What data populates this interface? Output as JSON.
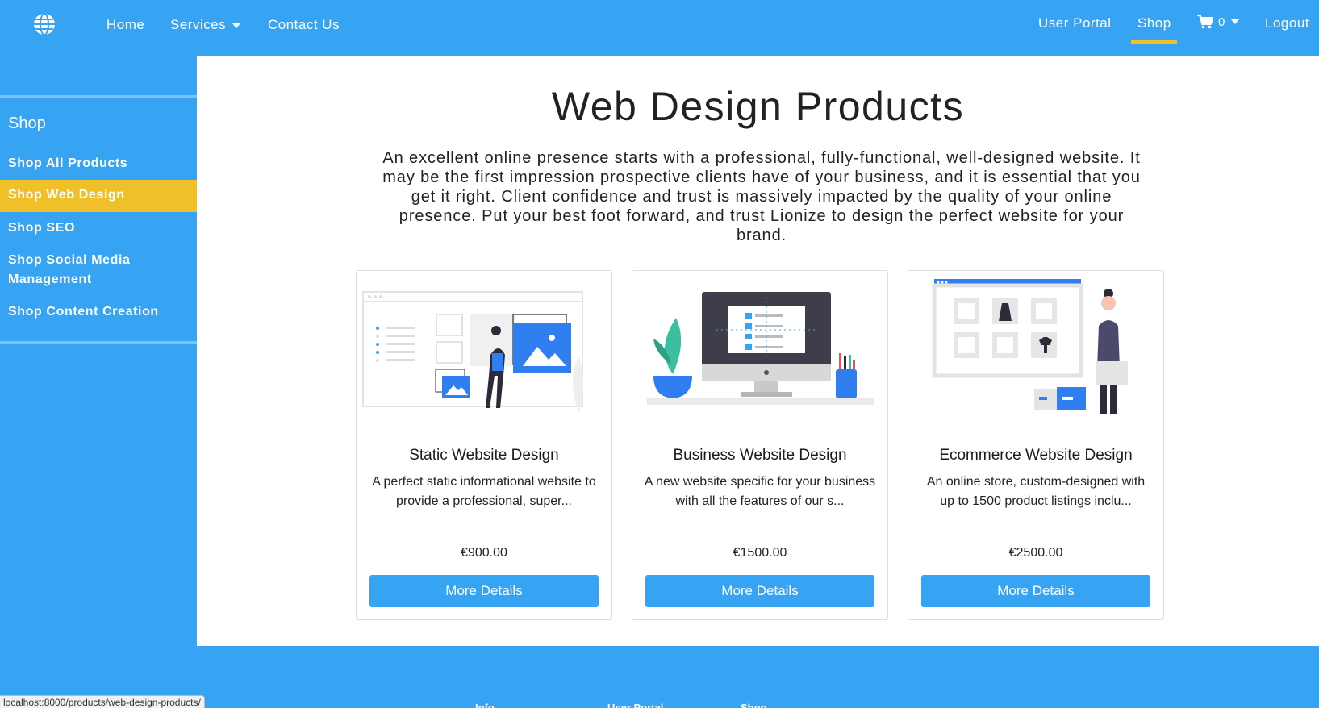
{
  "nav": {
    "home": "Home",
    "services": "Services",
    "contact": "Contact Us",
    "user_portal": "User Portal",
    "shop": "Shop",
    "cart_count": "0",
    "logout": "Logout"
  },
  "sidebar": {
    "title": "Shop",
    "items": [
      {
        "label": "Shop All Products",
        "active": false
      },
      {
        "label": "Shop Web Design",
        "active": true
      },
      {
        "label": "Shop SEO",
        "active": false
      },
      {
        "label": "Shop Social Media Management",
        "active": false
      },
      {
        "label": "Shop Content Creation",
        "active": false
      }
    ]
  },
  "main": {
    "title": "Web Design Products",
    "intro": "An excellent online presence starts with a professional, fully-functional, well-designed website. It may be the first impression prospective clients have of your business, and it is essential that you get it right. Client confidence and trust is massively impacted by the quality of your online presence. Put your best foot forward, and trust Lionize to design the perfect website for your brand.",
    "products": [
      {
        "title": "Static Website Design",
        "description": "A perfect static informational website to provide a professional, super...",
        "price": "€900.00",
        "button": "More Details"
      },
      {
        "title": "Business Website Design",
        "description": "A new website specific for your business with all the features of our s...",
        "price": "€1500.00",
        "button": "More Details"
      },
      {
        "title": "Ecommerce Website Design",
        "description": "An online store, custom-designed with up to 1500 product listings inclu...",
        "price": "€2500.00",
        "button": "More Details"
      }
    ]
  },
  "footer": {
    "headings": [
      "Info",
      "User Portal",
      "Shop"
    ]
  },
  "status_bar": {
    "url": "localhost:8000/products/web-design-products/"
  },
  "colors": {
    "brand_blue": "#36a3f3",
    "accent_yellow": "#f0c02a",
    "white": "#ffffff"
  },
  "icons": {
    "logo": "globe-icon",
    "cart": "shopping-cart-icon"
  }
}
